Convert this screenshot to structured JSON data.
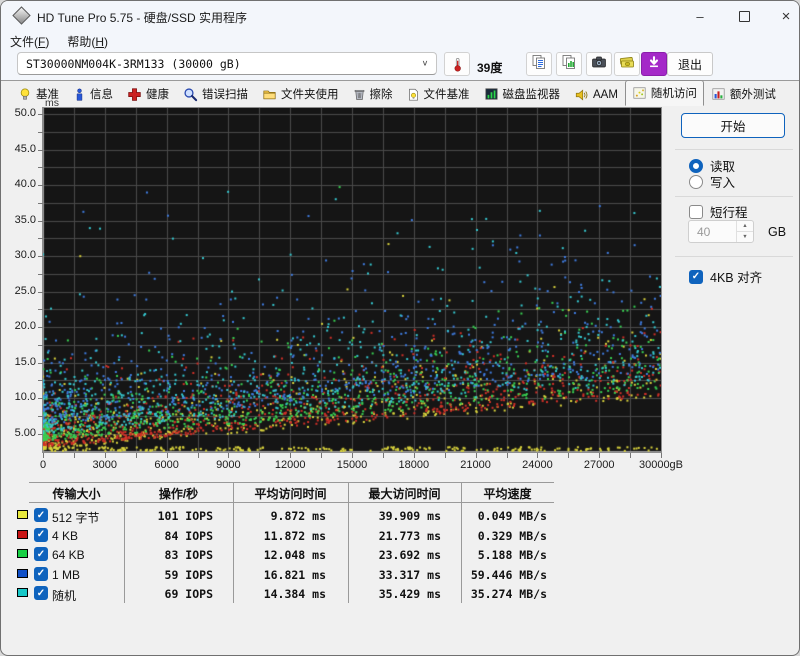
{
  "window": {
    "title": "HD Tune Pro 5.75 - 硬盘/SSD 实用程序",
    "controls": {
      "minimize": "–",
      "close": "×"
    }
  },
  "menu": {
    "items": [
      {
        "text": "文件",
        "key": "F"
      },
      {
        "text": "帮助",
        "key": "H"
      }
    ]
  },
  "toolbar": {
    "drive_select": "ST30000NM004K-3RM133 (30000 gB)",
    "temperature": "39度",
    "buttons": [
      {
        "id": "copy-text",
        "icon": "copy-text-icon"
      },
      {
        "id": "copy-image",
        "icon": "copy-image-icon"
      },
      {
        "id": "screenshot",
        "icon": "camera-icon"
      },
      {
        "id": "purchase",
        "icon": "money-icon"
      },
      {
        "id": "update",
        "icon": "download-icon"
      }
    ],
    "exit_label": "退出"
  },
  "tabs": [
    {
      "id": "benchmark",
      "label": "基准",
      "icon": "bulb",
      "selected": false
    },
    {
      "id": "info",
      "label": "信息",
      "icon": "info",
      "selected": false
    },
    {
      "id": "health",
      "label": "健康",
      "icon": "health",
      "selected": false
    },
    {
      "id": "error-scan",
      "label": "错误扫描",
      "icon": "scan",
      "selected": false
    },
    {
      "id": "folder-usage",
      "label": "文件夹使用",
      "icon": "folder",
      "selected": false
    },
    {
      "id": "erase",
      "label": "擦除",
      "icon": "erase",
      "selected": false
    },
    {
      "id": "file-benchmark",
      "label": "文件基准",
      "icon": "filebench",
      "selected": false
    },
    {
      "id": "disk-monitor",
      "label": "磁盘监视器",
      "icon": "monitor",
      "selected": false
    },
    {
      "id": "aam",
      "label": "AAM",
      "icon": "aam",
      "selected": false
    },
    {
      "id": "random-access",
      "label": "随机访问",
      "icon": "random",
      "selected": true
    },
    {
      "id": "extra-tests",
      "label": "额外测试",
      "icon": "extra",
      "selected": false
    }
  ],
  "controls": {
    "start": "开始",
    "read": "读取",
    "write": "写入",
    "read_selected": true,
    "short_stroke": "短行程",
    "short_stroke_checked": false,
    "capacity_value": "40",
    "capacity_unit": "GB",
    "align_4kb": "4KB 对齐",
    "align_4kb_checked": true
  },
  "chart_data": {
    "type": "scatter",
    "title": "随机访问时间散点图",
    "ylabel": "ms",
    "xlabel": "gB",
    "x_range": [
      0,
      30000
    ],
    "y_range": [
      2.5,
      50.85
    ],
    "grid": {
      "x_step": 1500,
      "y_step": 2.5,
      "color": "#4b4b4b",
      "background": "#151515"
    },
    "y_ticks": {
      "values": [
        50,
        45,
        40,
        35,
        30,
        25,
        20,
        15,
        10,
        5
      ],
      "labels": [
        "50.0",
        "45.0",
        "40.0",
        "35.0",
        "30.0",
        "25.0",
        "20.0",
        "15.0",
        "10.0",
        "5.00"
      ]
    },
    "x_ticks": {
      "values": [
        0,
        3000,
        6000,
        9000,
        12000,
        15000,
        18000,
        21000,
        24000,
        27000,
        30000
      ],
      "labels": [
        "0",
        "3000",
        "6000",
        "9000",
        "12000",
        "15000",
        "18000",
        "21000",
        "24000",
        "27000",
        "30000gB"
      ]
    },
    "series": [
      {
        "name": "512 字节",
        "color": "#d8d23c",
        "iops": 101,
        "avg_ms": 9.872,
        "max_ms": 39.909,
        "avg_speed_mbs": 0.049,
        "gen": {
          "count": 560,
          "base_add": 0.0,
          "exp_mean": 3.2,
          "cap": 26
        }
      },
      {
        "name": "4 KB",
        "color": "#d03028",
        "iops": 84,
        "avg_ms": 11.872,
        "max_ms": 21.773,
        "avg_speed_mbs": 0.329,
        "gen": {
          "count": 850,
          "base_add": 0.3,
          "exp_mean": 3.0,
          "cap": 22
        }
      },
      {
        "name": "64 KB",
        "color": "#38d052",
        "iops": 83,
        "avg_ms": 12.048,
        "max_ms": 23.692,
        "avg_speed_mbs": 5.188,
        "gen": {
          "count": 760,
          "base_add": 1.2,
          "exp_mean": 3.4,
          "cap": 24
        }
      },
      {
        "name": "1 MB",
        "color": "#3f7ce0",
        "iops": 59,
        "avg_ms": 16.821,
        "max_ms": 33.317,
        "avg_speed_mbs": 59.446,
        "gen": {
          "count": 660,
          "base_add": 3.5,
          "exp_mean": 5.0,
          "cap": 33
        }
      },
      {
        "name": "随机",
        "color": "#35c8d0",
        "iops": 69,
        "avg_ms": 14.384,
        "max_ms": 35.429,
        "avg_speed_mbs": 35.274,
        "gen": {
          "count": 650,
          "base_add": 2.2,
          "exp_mean": 5.4,
          "cap": 35
        }
      }
    ],
    "bottom_band": {
      "color": "#d8d23c",
      "count": 230,
      "ms_min": 2.55,
      "ms_max": 3.1
    },
    "outliers": {
      "count": 26,
      "ms_min": 27,
      "ms_max": 40
    }
  },
  "table": {
    "headers": [
      "传输大小",
      "操作/秒",
      "平均访问时间",
      "最大访问时间",
      "平均速度"
    ],
    "rows": [
      {
        "color": "#e8e83c",
        "label": "512 字节",
        "checked": true,
        "ops": "101 IOPS",
        "avg": "9.872 ms",
        "max": "39.909 ms",
        "speed": "0.049 MB/s"
      },
      {
        "color": "#c81414",
        "label": "4 KB",
        "checked": true,
        "ops": "84 IOPS",
        "avg": "11.872 ms",
        "max": "21.773 ms",
        "speed": "0.329 MB/s"
      },
      {
        "color": "#18d044",
        "label": "64 KB",
        "checked": true,
        "ops": "83 IOPS",
        "avg": "12.048 ms",
        "max": "23.692 ms",
        "speed": "5.188 MB/s"
      },
      {
        "color": "#1050c8",
        "label": "1 MB",
        "checked": true,
        "ops": "59 IOPS",
        "avg": "16.821 ms",
        "max": "33.317 ms",
        "speed": "59.446 MB/s"
      },
      {
        "color": "#18c8c8",
        "label": "随机",
        "checked": true,
        "ops": "69 IOPS",
        "avg": "14.384 ms",
        "max": "35.429 ms",
        "speed": "35.274 MB/s"
      }
    ]
  }
}
